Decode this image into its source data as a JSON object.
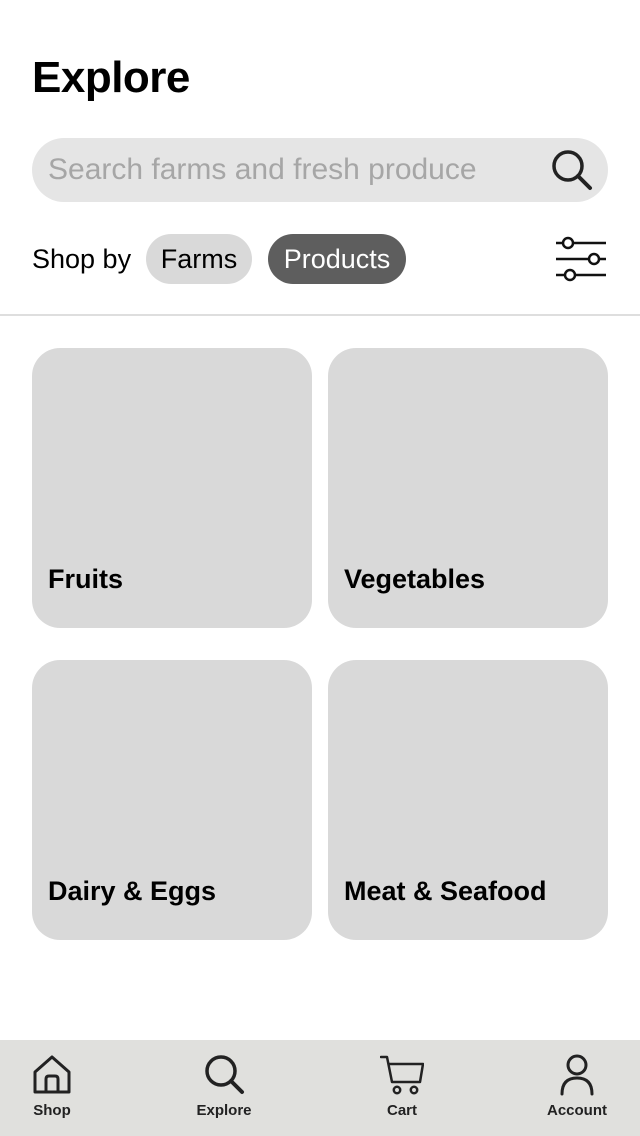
{
  "page": {
    "title": "Explore"
  },
  "search": {
    "placeholder": "Search farms and fresh produce",
    "value": "",
    "icon": "search-icon"
  },
  "shop_by": {
    "label": "Shop by",
    "options": [
      {
        "label": "Farms",
        "selected": false
      },
      {
        "label": "Products",
        "selected": true
      }
    ],
    "filter_icon": "sliders-icon"
  },
  "categories": [
    {
      "label": "Fruits"
    },
    {
      "label": "Vegetables"
    },
    {
      "label": "Dairy & Eggs"
    },
    {
      "label": "Meat & Seafood"
    }
  ],
  "bottom_nav": {
    "items": [
      {
        "label": "Shop",
        "icon": "home-icon"
      },
      {
        "label": "Explore",
        "icon": "search-icon",
        "active": true
      },
      {
        "label": "Cart",
        "icon": "cart-icon"
      },
      {
        "label": "Account",
        "icon": "person-icon"
      }
    ]
  },
  "colors": {
    "chip_selected_bg": "#5e5e5e",
    "chip_unselected_bg": "#d9d9d9",
    "card_bg": "#d9d9d9",
    "search_bg": "#e5e5e5",
    "nav_bg": "#e0e0dd"
  }
}
